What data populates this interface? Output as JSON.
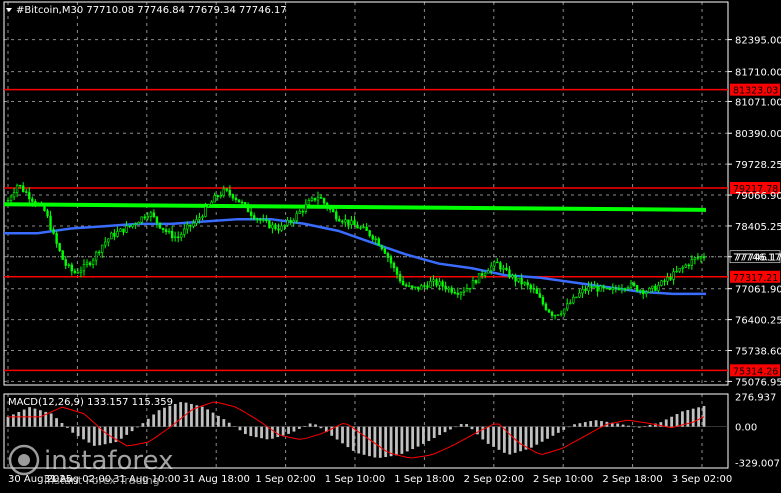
{
  "header": {
    "symbol_timeframe": "#Bitcoin,M30",
    "ohlc": "77710.08 77746.84 77679.34 77746.17"
  },
  "indicator": {
    "label": "MACD(12,26,9) 133.157 115.359"
  },
  "watermark": {
    "brand": "instaforex",
    "tagline": "Instant Forex Trading"
  },
  "colors": {
    "background": "#000000",
    "candle": "#00ff00",
    "ma_fast": "#00ff00",
    "ma_slow": "#3a6cff",
    "level": "#ff0000",
    "macd_hist": "#c0c0c0",
    "macd_signal": "#ff0000",
    "text": "#ffffff"
  },
  "chart_data": {
    "type": "candlestick",
    "price_axis": {
      "range": [
        75000,
        83200
      ],
      "ticks": [
        "82395.00",
        "81710.00",
        "81071.00",
        "80390.00",
        "79728.25",
        "79066.90",
        "78405.25",
        "77746.17",
        "77061.90",
        "76400.25",
        "75738.60",
        "75076.95"
      ]
    },
    "time_axis": {
      "labels": [
        "30 Aug 2025",
        "31 Aug 02:00",
        "31 Aug 10:00",
        "31 Aug 18:00",
        "1 Sep 02:00",
        "1 Sep 10:00",
        "1 Sep 18:00",
        "2 Sep 02:00",
        "2 Sep 10:00",
        "2 Sep 18:00",
        "3 Sep 02:00"
      ]
    },
    "current_price": 77746.17,
    "levels": [
      {
        "value": 81323.03,
        "label": "81323.03"
      },
      {
        "value": 79217.78,
        "label": "79217.78"
      },
      {
        "value": 77317.21,
        "label": "77317.21"
      },
      {
        "value": 75314.26,
        "label": "75314.26"
      }
    ],
    "price_path": [
      78950,
      79300,
      79100,
      78900,
      78700,
      78100,
      77600,
      77400,
      77500,
      77700,
      78000,
      78200,
      78300,
      78400,
      78550,
      78700,
      78450,
      78250,
      78150,
      78350,
      78500,
      78750,
      79000,
      79150,
      79050,
      78850,
      78650,
      78500,
      78400,
      78350,
      78500,
      78700,
      78900,
      79050,
      78800,
      78600,
      78500,
      78400,
      78300,
      78150,
      77900,
      77500,
      77150,
      77050,
      77100,
      77200,
      77150,
      77050,
      77000,
      77100,
      77300,
      77500,
      77600,
      77400,
      77250,
      77150,
      77000,
      76700,
      76500,
      76600,
      76800,
      77000,
      77100,
      77050,
      77000,
      77100,
      77150,
      77050,
      77000,
      77100,
      77250,
      77400,
      77550,
      77700,
      77750
    ],
    "ma_fast": [
      78870,
      78750
    ],
    "ma_slow_path": [
      78250,
      78250,
      78350,
      78400,
      78450,
      78450,
      78500,
      78550,
      78550,
      78450,
      78300,
      78050,
      77800,
      77600,
      77500,
      77350,
      77300,
      77200,
      77100,
      77000,
      76950,
      76950
    ],
    "macd_axis": {
      "range": [
        -380,
        300
      ],
      "ticks": [
        "276.937",
        "0.00",
        "-329.007"
      ]
    },
    "macd_path": [
      90,
      180,
      120,
      -60,
      -180,
      -140,
      0,
      160,
      230,
      180,
      60,
      -80,
      -120,
      -60,
      40,
      -100,
      -240,
      -290,
      -260,
      -170,
      -60,
      40,
      -150,
      -260,
      -200,
      -90,
      20,
      60,
      30,
      -10,
      40,
      140,
      190
    ]
  }
}
